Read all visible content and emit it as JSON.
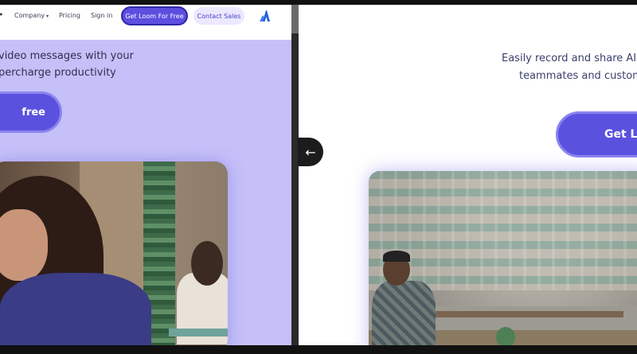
{
  "left_pane": {
    "nav": {
      "company_label": "Company",
      "company_caret": "▾",
      "pricing_label": "Pricing",
      "signin_label": "Sign in",
      "cta_label": "Get Loom For Free",
      "contact_label": "Contact Sales",
      "logo_icon": "atlassian-logo-icon"
    },
    "hero": {
      "line1": "video messages with your",
      "line2": "percharge productivity",
      "cta_label": "free"
    }
  },
  "compare": {
    "back_arrow": "←"
  },
  "right_pane": {
    "hero": {
      "line1": "Easily record and share AI-p",
      "line2": "teammates and custome",
      "cta_label": "Get Loo"
    }
  },
  "colors": {
    "primary": "#5a52df",
    "hero_bg": "#c5c0f8"
  }
}
